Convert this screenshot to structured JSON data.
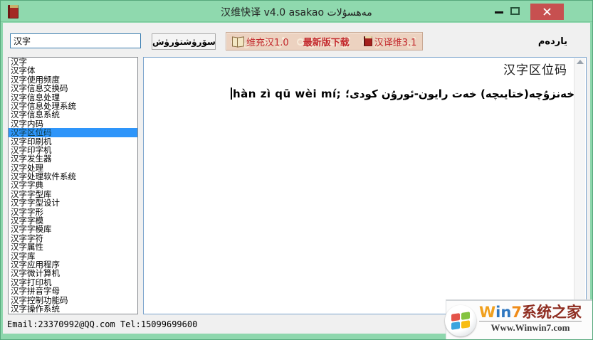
{
  "window": {
    "title": "汉维快译 v4.0  asakao مەھسۇلات",
    "colors": {
      "titlebar": "#8fd9ae",
      "close_button": "#c75050",
      "toolbar_bg": "#ecd2c0",
      "accent_red": "#c2262a",
      "selection_blue": "#2e95fa"
    }
  },
  "toolbar": {
    "search_value": "汉字",
    "search_button_label": "سۆرۈشتۈرۈش",
    "menu_items": [
      {
        "label": "维充汉1.0",
        "icon": "open-book-icon"
      },
      {
        "label": "最新版下载",
        "icon": "none"
      },
      {
        "label": "汉译维3.1",
        "icon": "red-book-icon"
      }
    ],
    "help_label": "ياردەم"
  },
  "sidebar": {
    "selected_index": 8,
    "items": [
      "汉字",
      "汉字体",
      "汉字使用频度",
      "汉字信息交换码",
      "汉字信息处理",
      "汉字信息处理系统",
      "汉字信息系统",
      "汉字内码",
      "汉字区位码",
      "汉字印刷机",
      "汉字印字机",
      "汉字发生器",
      "汉字处理",
      "汉字处理软件系统",
      "汉字字典",
      "汉字字型库",
      "汉字字型设计",
      "汉字字形",
      "汉字字模",
      "汉字字模库",
      "汉字字符",
      "汉字属性",
      "汉字库",
      "汉字应用程序",
      "汉字微计算机",
      "汉字打印机",
      "汉字拼音字母",
      "汉字控制功能码",
      "汉字操作系统"
    ]
  },
  "main": {
    "entry_title": "汉字区位码",
    "pinyin": "hàn zì qū wèi mí;",
    "uyghur": "خەنزۇچە(ختايىچە) خەت رايون-ئورۇن كودى؛"
  },
  "statusbar": {
    "text": "Email:23370992@QQ.com Tel:15099699600"
  },
  "watermark": {
    "letters": [
      "W",
      "i",
      "n",
      "7"
    ],
    "brand_suffix": "系统之家",
    "url": "Www.Winwin7.com"
  }
}
